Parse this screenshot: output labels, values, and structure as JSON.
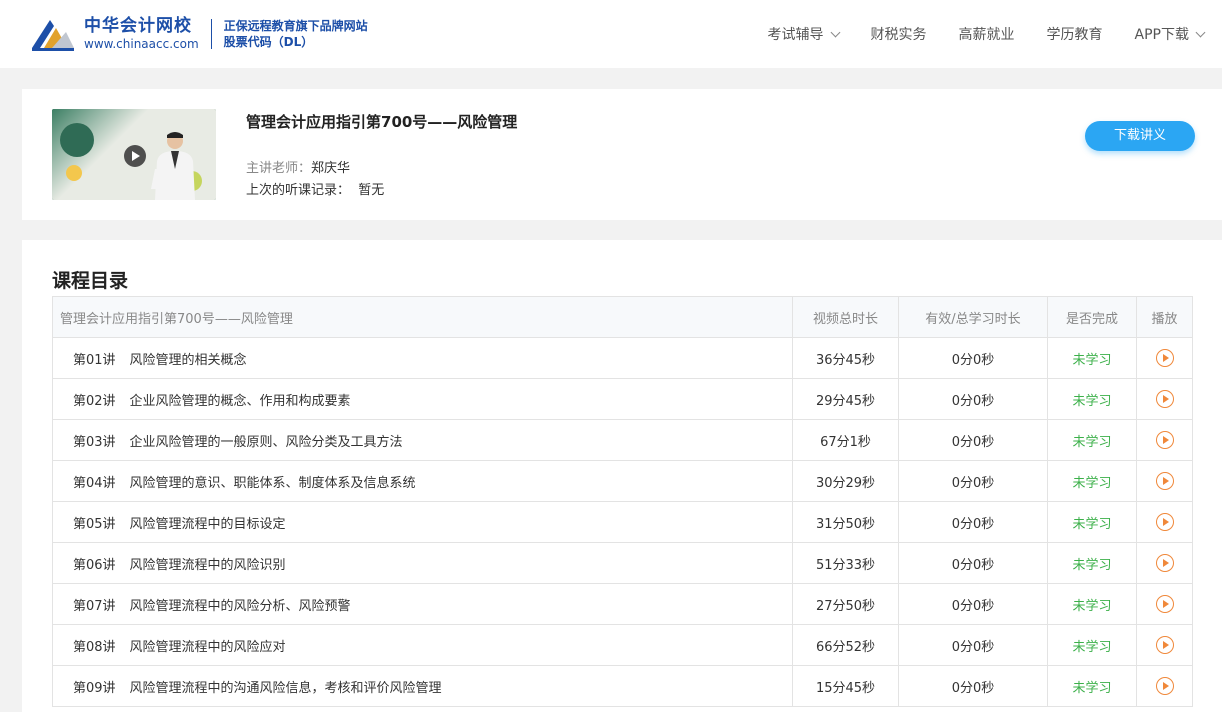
{
  "header": {
    "logo_cn": "中华会计网校",
    "logo_url": "www.chinaacc.com",
    "slogan_line1": "正保远程教育旗下品牌网站",
    "slogan_line2": "股票代码（DL）",
    "nav": [
      {
        "label": "考试辅导",
        "has_dropdown": true
      },
      {
        "label": "财税实务",
        "has_dropdown": false
      },
      {
        "label": "高薪就业",
        "has_dropdown": false
      },
      {
        "label": "学历教育",
        "has_dropdown": false
      },
      {
        "label": "APP下载",
        "has_dropdown": true
      }
    ]
  },
  "course": {
    "title": "管理会计应用指引第700号——风险管理",
    "teacher_label": "主讲老师：",
    "teacher_name": "郑庆华",
    "last_label": "上次的听课记录：",
    "last_value": "暂无",
    "download_label": "下载讲义"
  },
  "catalog": {
    "title": "课程目录",
    "headers": [
      "管理会计应用指引第700号——风险管理",
      "视频总时长",
      "有效/总学习时长",
      "是否完成",
      "播放"
    ],
    "rows": [
      {
        "no": "第01讲",
        "name": "风险管理的相关概念",
        "duration": "36分45秒",
        "studied": "0分0秒",
        "status": "未学习"
      },
      {
        "no": "第02讲",
        "name": "企业风险管理的概念、作用和构成要素",
        "duration": "29分45秒",
        "studied": "0分0秒",
        "status": "未学习"
      },
      {
        "no": "第03讲",
        "name": "企业风险管理的一般原则、风险分类及工具方法",
        "duration": "67分1秒",
        "studied": "0分0秒",
        "status": "未学习"
      },
      {
        "no": "第04讲",
        "name": "风险管理的意识、职能体系、制度体系及信息系统",
        "duration": "30分29秒",
        "studied": "0分0秒",
        "status": "未学习"
      },
      {
        "no": "第05讲",
        "name": "风险管理流程中的目标设定",
        "duration": "31分50秒",
        "studied": "0分0秒",
        "status": "未学习"
      },
      {
        "no": "第06讲",
        "name": "风险管理流程中的风险识别",
        "duration": "51分33秒",
        "studied": "0分0秒",
        "status": "未学习"
      },
      {
        "no": "第07讲",
        "name": "风险管理流程中的风险分析、风险预警",
        "duration": "27分50秒",
        "studied": "0分0秒",
        "status": "未学习"
      },
      {
        "no": "第08讲",
        "name": "风险管理流程中的风险应对",
        "duration": "66分52秒",
        "studied": "0分0秒",
        "status": "未学习"
      },
      {
        "no": "第09讲",
        "name": "风险管理流程中的沟通风险信息，考核和评价风险管理",
        "duration": "15分45秒",
        "studied": "0分0秒",
        "status": "未学习"
      }
    ]
  },
  "colors": {
    "brand": "#1d4fa8",
    "accent": "#2ba6f3",
    "status_green": "#3cb04a",
    "play_orange": "#f0883a"
  }
}
